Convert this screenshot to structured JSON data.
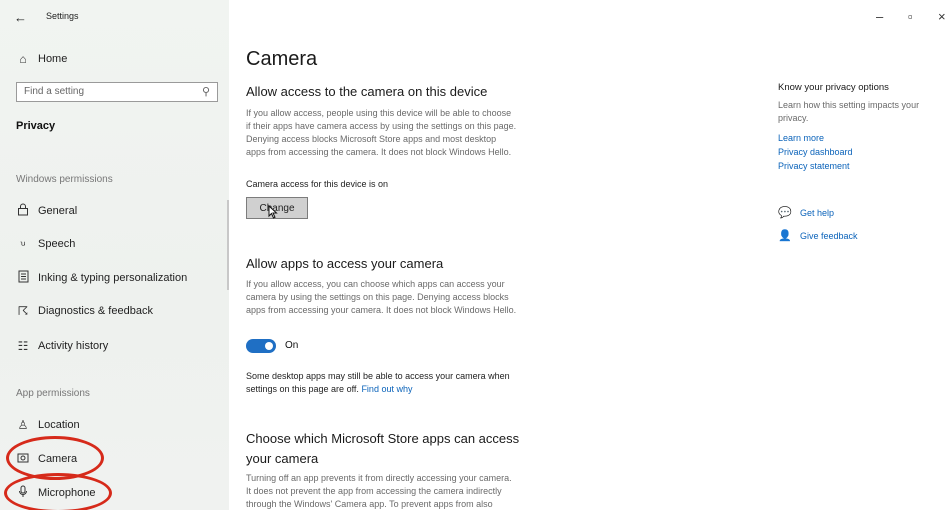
{
  "window": {
    "title": "Settings",
    "back": "←",
    "controls": {
      "minimize": "–",
      "maximize": "▫",
      "close": "×"
    }
  },
  "sidebar": {
    "home": "Home",
    "search_placeholder": "Find a setting",
    "category": "Privacy",
    "windows_permissions_header": "Windows permissions",
    "windows_permissions": [
      {
        "label": "General",
        "icon": "lock-icon"
      },
      {
        "label": "Speech",
        "icon": "speech-icon"
      },
      {
        "label": "Inking & typing personalization",
        "icon": "inking-icon"
      },
      {
        "label": "Diagnostics & feedback",
        "icon": "diagnostics-icon"
      },
      {
        "label": "Activity history",
        "icon": "activity-icon"
      }
    ],
    "app_permissions_header": "App permissions",
    "app_permissions": [
      {
        "label": "Location",
        "icon": "location-icon"
      },
      {
        "label": "Camera",
        "icon": "camera-icon"
      },
      {
        "label": "Microphone",
        "icon": "microphone-icon"
      }
    ],
    "highlight_color": "#d62a1a"
  },
  "main": {
    "title": "Camera",
    "section1": {
      "heading": "Allow access to the camera on this device",
      "lines": [
        "If you allow access, people using this device will be able to choose",
        "if their apps have camera access by using the settings on this page.",
        "Denying access blocks Microsoft Store apps and most desktop",
        "apps from accessing the camera. It does not block Windows Hello."
      ],
      "status": "Camera access for this device is on",
      "button": "Change"
    },
    "section2": {
      "heading": "Allow apps to access your camera",
      "lines": [
        "If you allow access, you can choose which apps can access your",
        "camera by using the settings on this page. Denying access blocks",
        "apps from accessing your camera. It does not block Windows Hello."
      ],
      "toggle_label": "On",
      "toggle_state": "on",
      "note_lines": [
        "Some desktop apps may still be able to access your camera when",
        "settings on this page are off."
      ],
      "note_link": "Find out why"
    },
    "section3": {
      "heading_lines": [
        "Choose which Microsoft Store apps can access",
        "your camera"
      ],
      "lines": [
        "Turning off an app prevents it from directly accessing your camera.",
        "It does not prevent the app from accessing the camera indirectly",
        "through the Windows' Camera app. To prevent apps from also"
      ]
    }
  },
  "right": {
    "title": "Know your privacy options",
    "text_lines": [
      "Learn how this setting impacts your",
      "privacy."
    ],
    "links": [
      "Learn more",
      "Privacy dashboard",
      "Privacy statement"
    ],
    "help": "Get help",
    "feedback": "Give feedback"
  },
  "colors": {
    "accent": "#1f6fc4",
    "link": "#0b63ba"
  }
}
